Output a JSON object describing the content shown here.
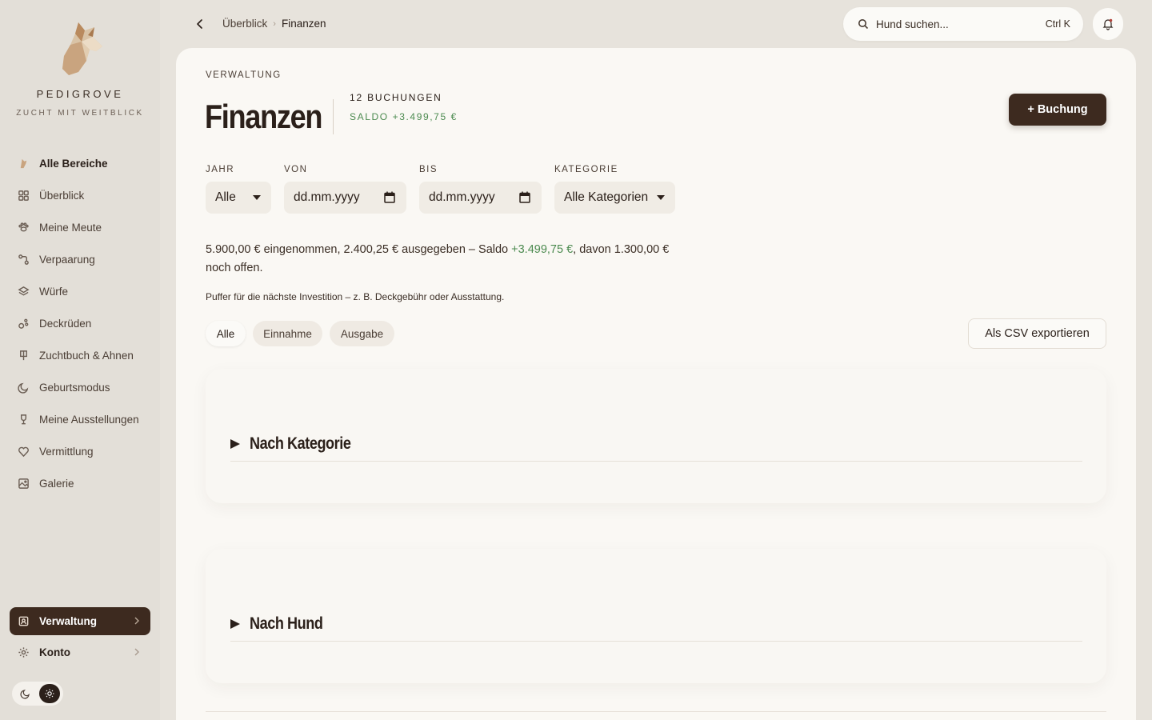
{
  "brand": {
    "name": "PEDIGROVE",
    "tagline": "ZUCHT MIT WEITBLICK"
  },
  "nav": {
    "items": [
      {
        "label": "Alle Bereiche",
        "icon": "dog-icon"
      },
      {
        "label": "Überblick",
        "icon": "grid-icon"
      },
      {
        "label": "Meine Meute",
        "icon": "paw-icon"
      },
      {
        "label": "Verpaarung",
        "icon": "pairing-icon"
      },
      {
        "label": "Würfe",
        "icon": "layers-icon"
      },
      {
        "label": "Deckrüden",
        "icon": "male-dog-icon"
      },
      {
        "label": "Zuchtbuch & Ahnen",
        "icon": "book-icon"
      },
      {
        "label": "Geburtsmodus",
        "icon": "moon-icon"
      },
      {
        "label": "Meine Ausstellungen",
        "icon": "trophy-icon"
      },
      {
        "label": "Vermittlung",
        "icon": "heart-icon"
      },
      {
        "label": "Galerie",
        "icon": "image-icon"
      }
    ],
    "admin_label": "Verwaltung",
    "account_label": "Konto"
  },
  "topbar": {
    "breadcrumb_parent": "Überblick",
    "breadcrumb_current": "Finanzen",
    "search_placeholder": "Hund suchen...",
    "search_shortcut": "Ctrl K"
  },
  "page": {
    "eyebrow": "VERWALTUNG",
    "title": "Finanzen",
    "count": "12 BUCHUNGEN",
    "saldo": "SALDO +3.499,75 €",
    "add_button": "+ Buchung"
  },
  "filters": {
    "year_label": "JAHR",
    "year_value": "Alle",
    "from_label": "VON",
    "from_value": "dd.mm.yyyy",
    "to_label": "BIS",
    "to_value": "dd.mm.yyyy",
    "category_label": "KATEGORIE",
    "category_value": "Alle Kategorien"
  },
  "summary": {
    "part1": "5.900,00 € eingenommen, 2.400,25 € ausgegeben – Saldo ",
    "saldo": "+3.499,75 €",
    "part2": ", davon 1.300,00 € noch offen.",
    "note": "Puffer für die nächste Investition – z. B. Deckgebühr oder Ausstattung."
  },
  "tabs": [
    "Alle",
    "Einnahme",
    "Ausgabe"
  ],
  "export_button": "Als CSV exportieren",
  "sections": [
    "Nach Kategorie",
    "Nach Hund"
  ],
  "colors": {
    "accent": "#3d2a1f",
    "positive": "#4b8a4f",
    "background": "#e7e3dc",
    "card": "#faf8f4"
  }
}
